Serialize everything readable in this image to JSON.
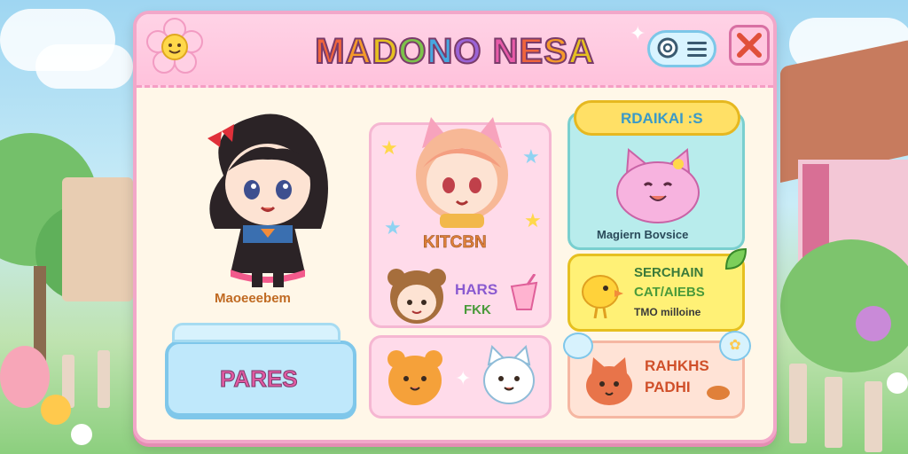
{
  "window": {
    "title": "MADONO NESA",
    "title_colors": [
      "#f0643c",
      "#f59a2a",
      "#e6c020",
      "#7cc24a",
      "#46a8e0",
      "#9a63d6",
      "#e85aa8"
    ]
  },
  "titlebar": {
    "logo_icon": "smiling-flower",
    "search_icon": "magnifier",
    "menu_icon": "hamburger",
    "close_icon": "close-x"
  },
  "characters": {
    "main_girl": {
      "name": "Maoeeebem"
    },
    "cat_girl": {
      "name": "KITCBN"
    },
    "bear_girl": {
      "line1": "HARS",
      "line2": "FKK"
    }
  },
  "buttons": {
    "pares": "PARES"
  },
  "panels": {
    "rdaikai": {
      "label": "RDAIKAI :S",
      "caption": "Magiern Bovsice"
    },
    "serchain": {
      "line1": "SERCHAIN",
      "line2": "CAT/AIEBS",
      "line3": "TMO milloine"
    },
    "rahkhs": {
      "line1": "RAHKHS",
      "line2": "PADHI"
    }
  },
  "colors": {
    "window_border": "#f2a7c9",
    "titlebar": "#ffc2dc",
    "pares_button": "#bfe8fb",
    "rdaikai_panel": "#b8ecec",
    "rdaikai_tab": "#ffe066",
    "serchain_panel": "#fff176"
  }
}
